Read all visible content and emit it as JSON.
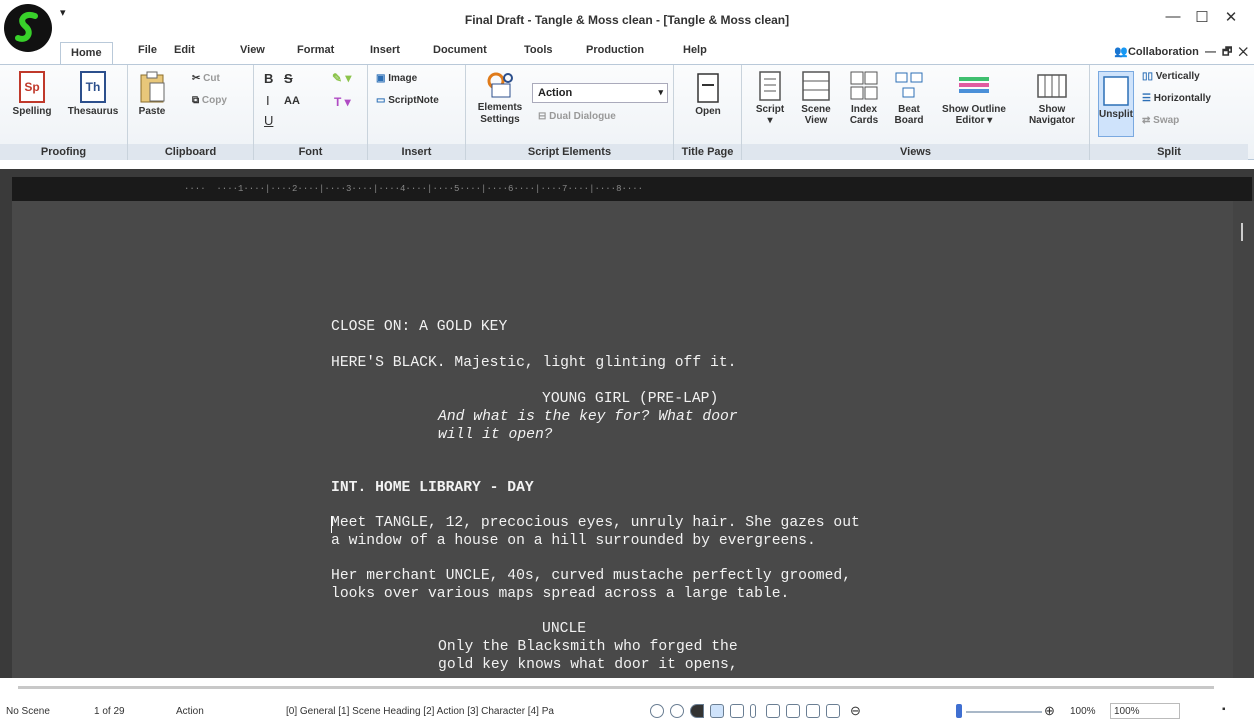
{
  "window": {
    "title": "Final Draft - Tangle & Moss clean - [Tangle & Moss clean]",
    "minimize": "—",
    "maximize": "☐",
    "close": "✕"
  },
  "qat": {
    "icon": "qat-dropdown-icon",
    "label": "▾"
  },
  "tabs": [
    "Home",
    "File",
    "Edit",
    "View",
    "Format",
    "Insert",
    "Document",
    "Tools",
    "Production",
    "Help"
  ],
  "collaboration": "Collaboration",
  "ribbon": {
    "proofing": {
      "label": "Proofing",
      "spelling": "Spelling",
      "thesaurus": "Thesaurus",
      "sp": "Sp",
      "th": "Th"
    },
    "clipboard": {
      "label": "Clipboard",
      "paste": "Paste",
      "cut": "Cut",
      "copy": "Copy"
    },
    "font": {
      "label": "Font",
      "bold": "B",
      "strike": "S",
      "italic": "I",
      "underline": "U",
      "caps": "AA",
      "highlight": "✎",
      "color": "T"
    },
    "insert": {
      "label": "Insert",
      "image": "Image",
      "scriptnote": "ScriptNote"
    },
    "script_elements": {
      "label": "Script Elements",
      "element_value": "Action",
      "settings": "Elements Settings",
      "dual": "Dual Dialogue"
    },
    "title_page": {
      "label": "Title Page",
      "open": "Open"
    },
    "views": {
      "label": "Views",
      "script": "Script",
      "scene_view": "Scene View",
      "index_cards": "Index Cards",
      "beat_board": "Beat Board",
      "outline": "Show Outline Editor",
      "navigator": "Show Navigator"
    },
    "split": {
      "label": "Split",
      "unsplit": "Unsplit",
      "vertically": "Vertically",
      "horizontally": "Horizontally",
      "swap": "Swap"
    }
  },
  "ruler": "····  ····1····|····2····|····3····|····4····|····5····|····6····|····7····|····8····",
  "script": [
    {
      "text": "CLOSE ON: A GOLD KEY",
      "style": "action"
    },
    {
      "text": "HERE'S BLACK. Majestic, light glinting off it.",
      "style": "action"
    },
    {
      "text": "YOUNG GIRL (PRE-LAP)",
      "style": "character"
    },
    {
      "text": "And what is the key for? What door",
      "style": "dialogue-italic"
    },
    {
      "text": "will it open?",
      "style": "dialogue-italic"
    },
    {
      "text": "INT. HOME LIBRARY - DAY",
      "style": "heading"
    },
    {
      "text": "Meet TANGLE, 12, precocious eyes, unruly hair. She gazes out",
      "style": "action"
    },
    {
      "text": "a window of a house on a hill surrounded by evergreens.",
      "style": "action"
    },
    {
      "text": "Her merchant UNCLE, 40s, curved mustache perfectly groomed,",
      "style": "action"
    },
    {
      "text": "looks over various maps spread across a large table.",
      "style": "action"
    },
    {
      "text": "UNCLE",
      "style": "character"
    },
    {
      "text": "Only the Blacksmith who forged the",
      "style": "dialogue"
    },
    {
      "text": "gold key knows what door it opens,",
      "style": "dialogue"
    }
  ],
  "status": {
    "scene": "No Scene",
    "page": "1 of 29",
    "element": "Action",
    "shortcuts": "[0] General [1] Scene Heading [2] Action [3] Character [4] Pa",
    "zoom_minus": "⊖",
    "zoom_plus": "⊕",
    "zoom": "100%",
    "zoom_input": "100%"
  },
  "colors": {
    "ribbon_label": "#dfe6ee",
    "page": "#494949",
    "accent": "#3f6fd1"
  }
}
